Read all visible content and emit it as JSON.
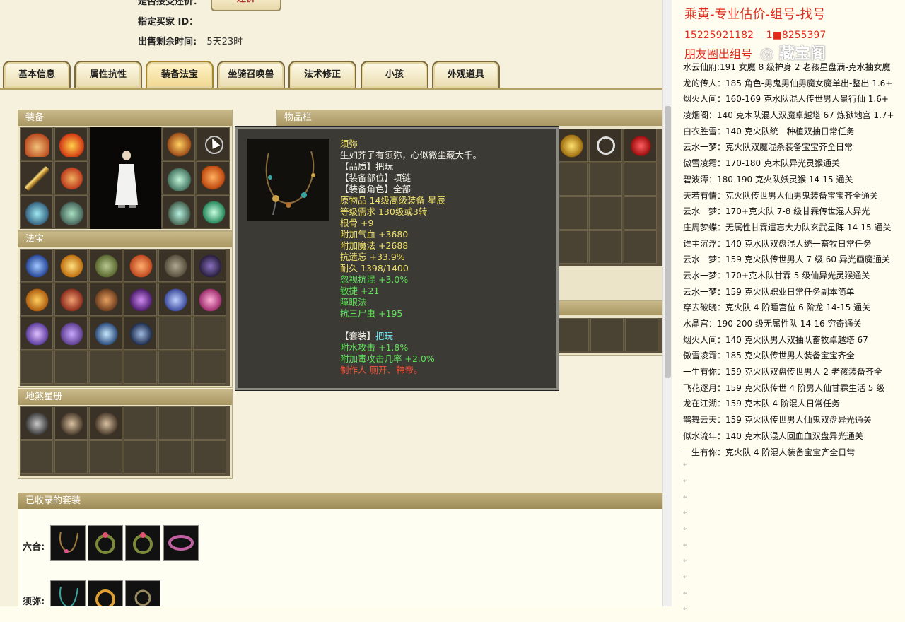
{
  "header": {
    "partial_label": "是否接受还价：",
    "buyer_label": "指定买家 ID：",
    "buyer_value": "",
    "time_label": "出售剩余时间:",
    "time_value": "5天23时",
    "bargain_button": "还价"
  },
  "tabs": [
    "基本信息",
    "属性抗性",
    "装备法宝",
    "坐骑召唤兽",
    "法术修正",
    "小孩",
    "外观道具"
  ],
  "active_tab": "装备法宝",
  "panels": {
    "equipment": "装备",
    "inventory": "物品栏",
    "treasure": "法宝",
    "star_book": "地煞星册",
    "sets": "已收录的套装"
  },
  "tooltip": {
    "name": "须弥",
    "desc": "生如芥子有须弥，心似微尘藏大千。",
    "quality": "【品质】把玩",
    "slot": "【装备部位】项链",
    "role": "【装备角色】全部",
    "origin": "原物品 14级高级装备 星辰",
    "requirement": "等级需求 130级或3转",
    "stat1": "根骨 +9",
    "stat2": "附加气血 +3680",
    "stat3": "附加魔法 +2688",
    "stat4": "抗遗忘 +33.9%",
    "durability": "耐久 1398/1400",
    "stat5": "忽视抗混 +3.0%",
    "stat6": "敏捷 +21",
    "stat7": "障眼法",
    "stat8": "抗三尸虫 +195",
    "set_label": "【套装】",
    "set_value": "把玩",
    "set1": "附水攻击 +1.8%",
    "set2": "附加毒攻击几率 +2.0%",
    "maker": "制作人 厕开、韩帝。"
  },
  "sets": [
    {
      "label": "六合:"
    },
    {
      "label": "须弥:"
    }
  ],
  "right": {
    "title": "乘黄-专业估价-组号-找号",
    "phone1": "15225921182",
    "phone2": "1■8255397",
    "friend": "朋友圈出组号",
    "watermark": "◎ 藏宝阁",
    "lines": [
      "水云仙府:191 女魔 8 级护身 2 老孩星盘满-克水抽女魔",
      "龙的传人：185 角色-男鬼男仙男魔女魔单出-整出 1.6+",
      "烟火人间：160-169 克水队混人传世男人景行仙 1.6+",
      "凌烟阁：140 克木队混人双魔卓越塔 67 炼狱地宫 1.7+",
      "白衣胜雪：140 克火队统一种植双抽日常任务",
      "云水一梦：克火队双魔混杀装备宝宝齐全日常",
      "傲雪凌霜：170-180 克木队异光灵猴通关",
      "碧波潭：180-190 克火队妖灵猴 14-15 通关",
      "天若有情：克火队传世男人仙男鬼装备宝宝齐全通关",
      "云水一梦：170+克火队 7-8 级甘霖传世混人异光",
      "庄周梦蝶：无属性甘霖遗忘大力队玄武星阵 14-15 通关",
      "谁主沉浮：140 克水队双盘混人统一畜牧日常任务",
      "云水一梦：159 克火队传世男人 7 级 60 异光画魔通关",
      "云水一梦：170+克木队甘霖 5 级仙异光灵猴通关",
      "云水一梦：159 克火队职业日常任务副本简单",
      "穿去破晓：克火队 4 阶睡宫位 6 阶龙 14-15 通关",
      "水晶宫：190-200 级无属性队 14-16 穷奇通关",
      "烟火人间：140 克火队男人双抽队畜牧卓越塔 67",
      "傲雪凌霜：185 克火队传世男人装备宝宝齐全",
      "一生有你：159 克火队双盘传世男人 2 老孩装备齐全",
      "飞花逐月：159 克火队传世 4 阶男人仙甘霖生活 5 级",
      "龙在江湖：159 克木队 4 阶混人日常任务",
      "鹊舞云天：159 克火队传世男人仙鬼双盘异光通关",
      "似水流年：140 克木队混人回血血双盘异光通关",
      "一生有你：克火队 4 阶混人装备宝宝齐全日常"
    ],
    "return_mark": "↵"
  },
  "colors": {
    "red": "#e02a1a",
    "gold": "#f0e26a",
    "green": "#5fe35a",
    "cyan": "#6ee8f2"
  }
}
